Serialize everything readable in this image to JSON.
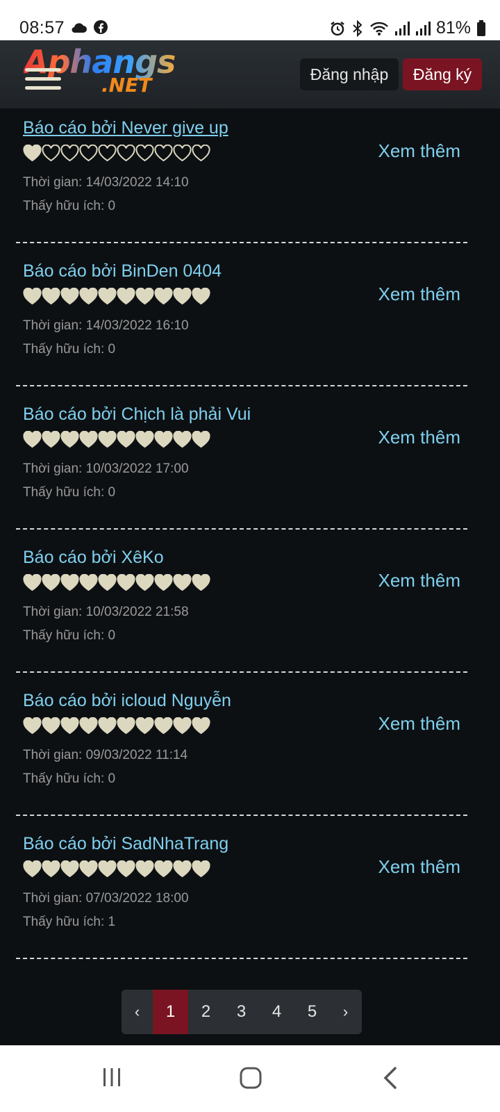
{
  "status_bar": {
    "time": "08:57",
    "left_icons": [
      "cloud-icon",
      "facebook-icon"
    ],
    "right_icons": [
      "alarm-icon",
      "bluetooth-icon",
      "wifi-icon",
      "signal-icon",
      "signal-icon",
      "battery-icon"
    ],
    "battery": "81%"
  },
  "header": {
    "logo_text": "Aphangs",
    "logo_sub": ".NET",
    "login_label": "Đăng nhập",
    "register_label": "Đăng ký",
    "colors": {
      "register_bg": "#7a1422",
      "login_bg": "#14181b",
      "accent_text": "#7fd0ee"
    }
  },
  "reports": [
    {
      "title": "Báo cáo bởi Never give up",
      "filled_hearts": 1,
      "total_hearts": 10,
      "more_label": "Xem thêm",
      "time": "Thời gian: 14/03/2022 14:10",
      "useful": "Thấy hữu ích: 0"
    },
    {
      "title": "Báo cáo bởi BinDen 0404",
      "filled_hearts": 10,
      "total_hearts": 10,
      "more_label": "Xem thêm",
      "time": "Thời gian: 14/03/2022 16:10",
      "useful": "Thấy hữu ích: 0"
    },
    {
      "title": "Báo cáo bởi Chịch là phải Vui",
      "filled_hearts": 10,
      "total_hearts": 10,
      "more_label": "Xem thêm",
      "time": "Thời gian: 10/03/2022 17:00",
      "useful": "Thấy hữu ích: 0"
    },
    {
      "title": "Báo cáo bởi XêKo",
      "filled_hearts": 10,
      "total_hearts": 10,
      "more_label": "Xem thêm",
      "time": "Thời gian: 10/03/2022 21:58",
      "useful": "Thấy hữu ích: 0"
    },
    {
      "title": "Báo cáo bởi icloud Nguyễn",
      "filled_hearts": 10,
      "total_hearts": 10,
      "more_label": "Xem thêm",
      "time": "Thời gian: 09/03/2022 11:14",
      "useful": "Thấy hữu ích: 0"
    },
    {
      "title": "Báo cáo bởi SadNhaTrang",
      "filled_hearts": 10,
      "total_hearts": 10,
      "more_label": "Xem thêm",
      "time": "Thời gian: 07/03/2022 18:00",
      "useful": "Thấy hữu ích: 1"
    }
  ],
  "pagination": {
    "prev": "‹",
    "pages": [
      "1",
      "2",
      "3",
      "4",
      "5"
    ],
    "active": "1",
    "next": "›"
  },
  "nav_bar": {
    "buttons": [
      "recents-icon",
      "home-icon",
      "back-icon"
    ]
  }
}
